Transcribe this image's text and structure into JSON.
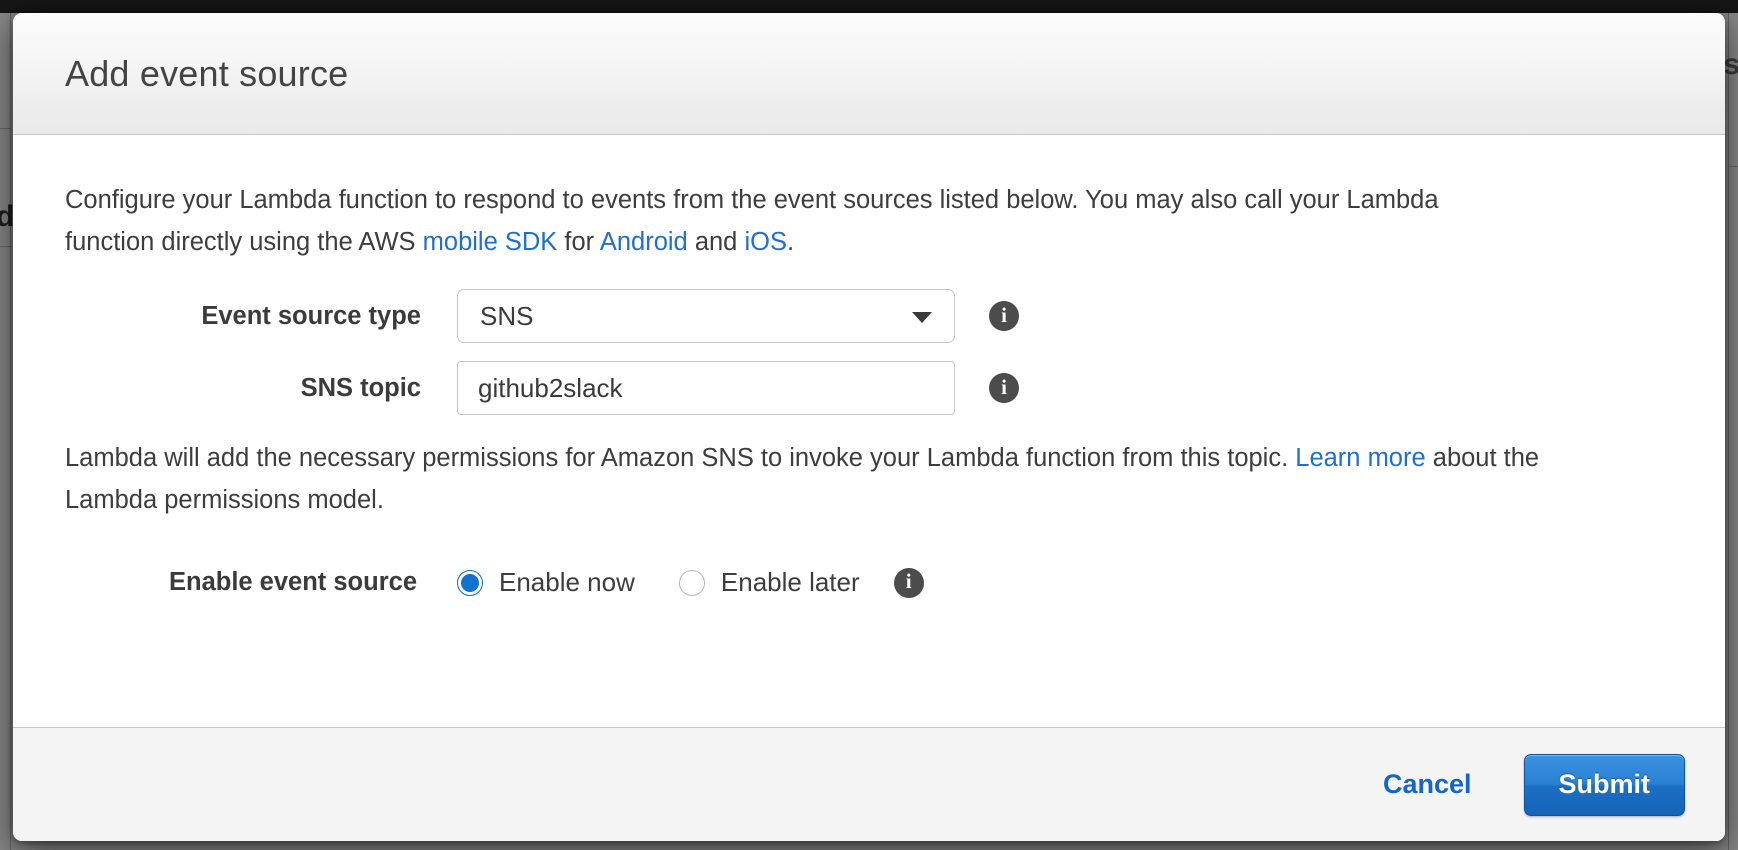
{
  "window": {
    "title": "Add event source"
  },
  "background": {
    "left_fragment": "d",
    "right_fragment": "s"
  },
  "body": {
    "intro": {
      "part1": "Configure your Lambda function to respond to events from the event sources listed below. You may also call your Lambda function directly using the AWS ",
      "link_sdk": "mobile SDK",
      "part2": " for ",
      "link_android": "Android",
      "part3": " and ",
      "link_ios": "iOS",
      "part4": "."
    },
    "permissions": {
      "part1": "Lambda will add the necessary permissions for Amazon SNS to invoke your Lambda function from this topic. ",
      "link_learn_more": "Learn more",
      "part2": " about the Lambda permissions model."
    }
  },
  "form": {
    "event_source_type": {
      "label": "Event source type",
      "value": "SNS",
      "options": [
        "SNS"
      ],
      "info_glyph": "i"
    },
    "sns_topic": {
      "label": "SNS topic",
      "value": "github2slack",
      "placeholder": "",
      "info_glyph": "i"
    },
    "enable_event_source": {
      "label": "Enable event source",
      "options": [
        {
          "label": "Enable now",
          "selected": true
        },
        {
          "label": "Enable later",
          "selected": false
        }
      ],
      "info_glyph": "i"
    }
  },
  "footer": {
    "cancel_label": "Cancel",
    "submit_label": "Submit"
  },
  "colors": {
    "link": "#1f6fd0",
    "primary_button": "#1a6fc4",
    "radio_selected": "#1272ce",
    "header_text": "#444444"
  }
}
